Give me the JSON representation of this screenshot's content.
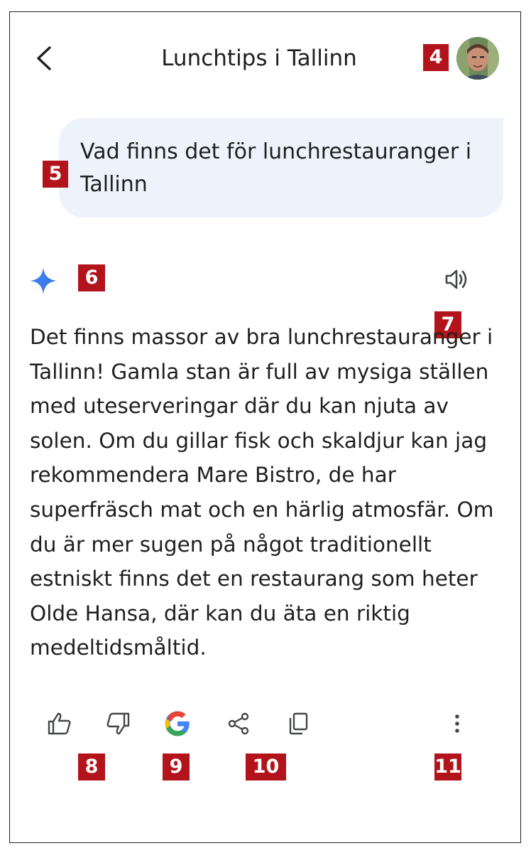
{
  "header": {
    "title": "Lunchtips i Tallinn"
  },
  "user_message": "Vad finns det för lunchrestauranger i Tallinn",
  "response": "Det finns massor av bra lunchrestauranger i Tallinn! Gamla stan är full av mysiga ställen med uteserveringar där du kan njuta av solen. Om du gillar fisk och skaldjur kan jag rekommendera Mare Bistro, de har superfräsch mat och en härlig atmosfär. Om du är mer sugen på något traditionellt estniskt finns det en restaurang som heter Olde Hansa, där kan du äta en riktig medeltidsmåltid.",
  "badges": {
    "avatar": "4",
    "prompt": "5",
    "gemini": "6",
    "speaker": "7",
    "feedback": "8",
    "google": "9",
    "share": "10",
    "more": "11"
  },
  "icons": {
    "back": "back-arrow-icon",
    "avatar": "user-avatar",
    "sparkle": "gemini-sparkle-icon",
    "speaker": "speaker-icon",
    "thumbs_up": "thumbs-up-icon",
    "thumbs_down": "thumbs-down-icon",
    "google": "google-g-icon",
    "share": "share-icon",
    "copy": "copy-icon",
    "more": "more-vert-icon"
  },
  "colors": {
    "badge": "#b3141b",
    "bubble": "#eef3fb",
    "text": "#1f1f1f",
    "icon": "#444746"
  }
}
